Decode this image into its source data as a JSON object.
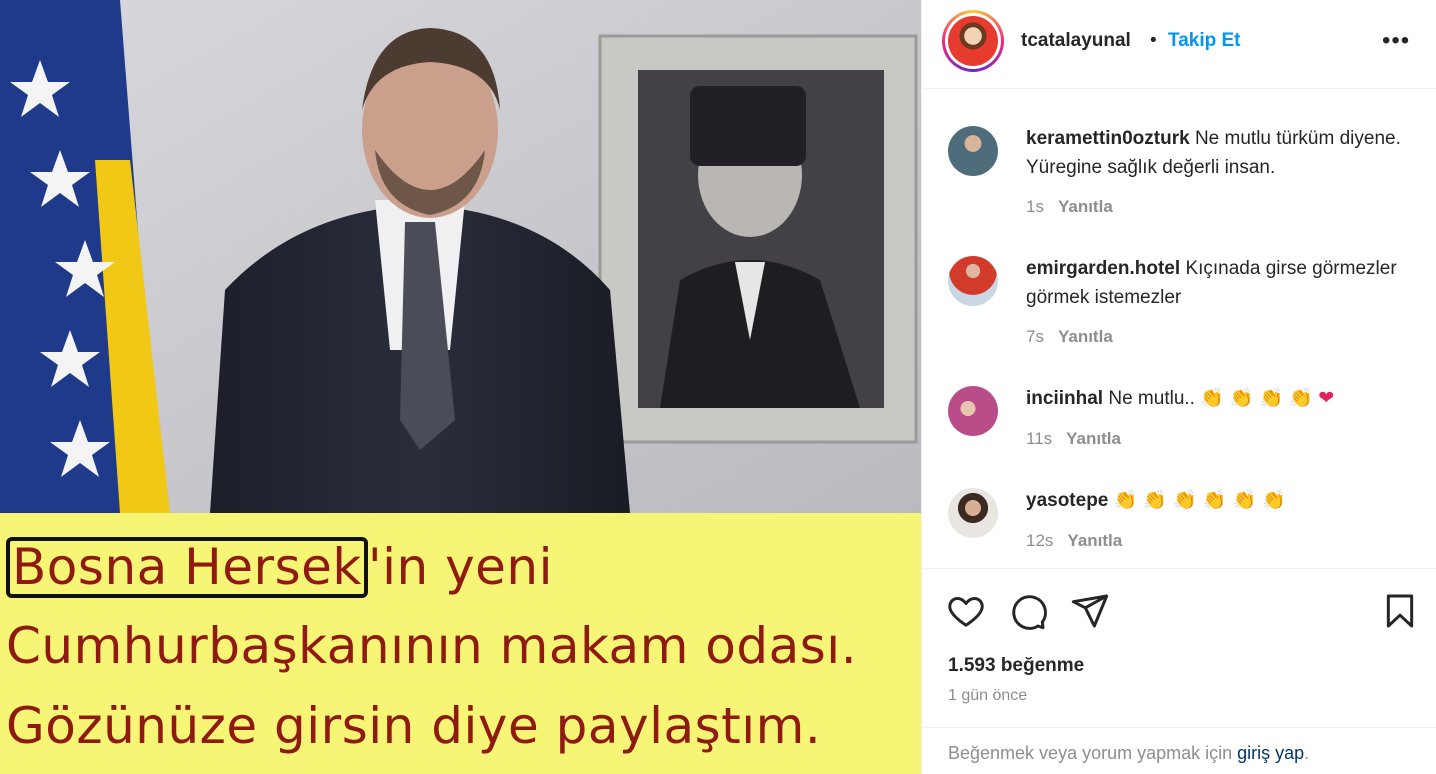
{
  "media": {
    "caption": {
      "highlight": "Bosna Hersek",
      "line1_rest": "'in yeni",
      "line2": "Cumhurbaşkanının makam odası.",
      "line3": "Gözünüze girsin diye paylaştım."
    }
  },
  "header": {
    "username": "tcatalayunal",
    "separator": "•",
    "follow_label": "Takip Et",
    "more_icon": "more-options-icon"
  },
  "comments": [
    {
      "username": "keramettin0ozturk",
      "text": "Ne mutlu türküm diyene. Yüregine sağlık değerli insan.",
      "time": "1s",
      "reply": "Yanıtla"
    },
    {
      "username": "emirgarden.hotel",
      "text": "Kıçınada girse görmezler görmek istemezler",
      "time": "7s",
      "reply": "Yanıtla"
    },
    {
      "username": "inciinhal",
      "text": "Ne mutlu..",
      "emojis": "👏 👏 👏 👏",
      "heart": "❤",
      "time": "11s",
      "reply": "Yanıtla"
    },
    {
      "username": "yasotepe",
      "text": "",
      "emojis": "👏 👏 👏 👏 👏 👏",
      "time": "12s",
      "reply": "Yanıtla"
    }
  ],
  "actions": {
    "likes": "1.593 beğenme",
    "time_ago": "1 gün önce",
    "login_prompt": "Beğenmek veya yorum yapmak için",
    "login_link": "giriş yap",
    "login_suffix": "."
  },
  "colors": {
    "accent": "#0095f6",
    "caption_bg": "#f7f575",
    "caption_text": "#8e1a12",
    "muted": "#8e8e8e"
  }
}
